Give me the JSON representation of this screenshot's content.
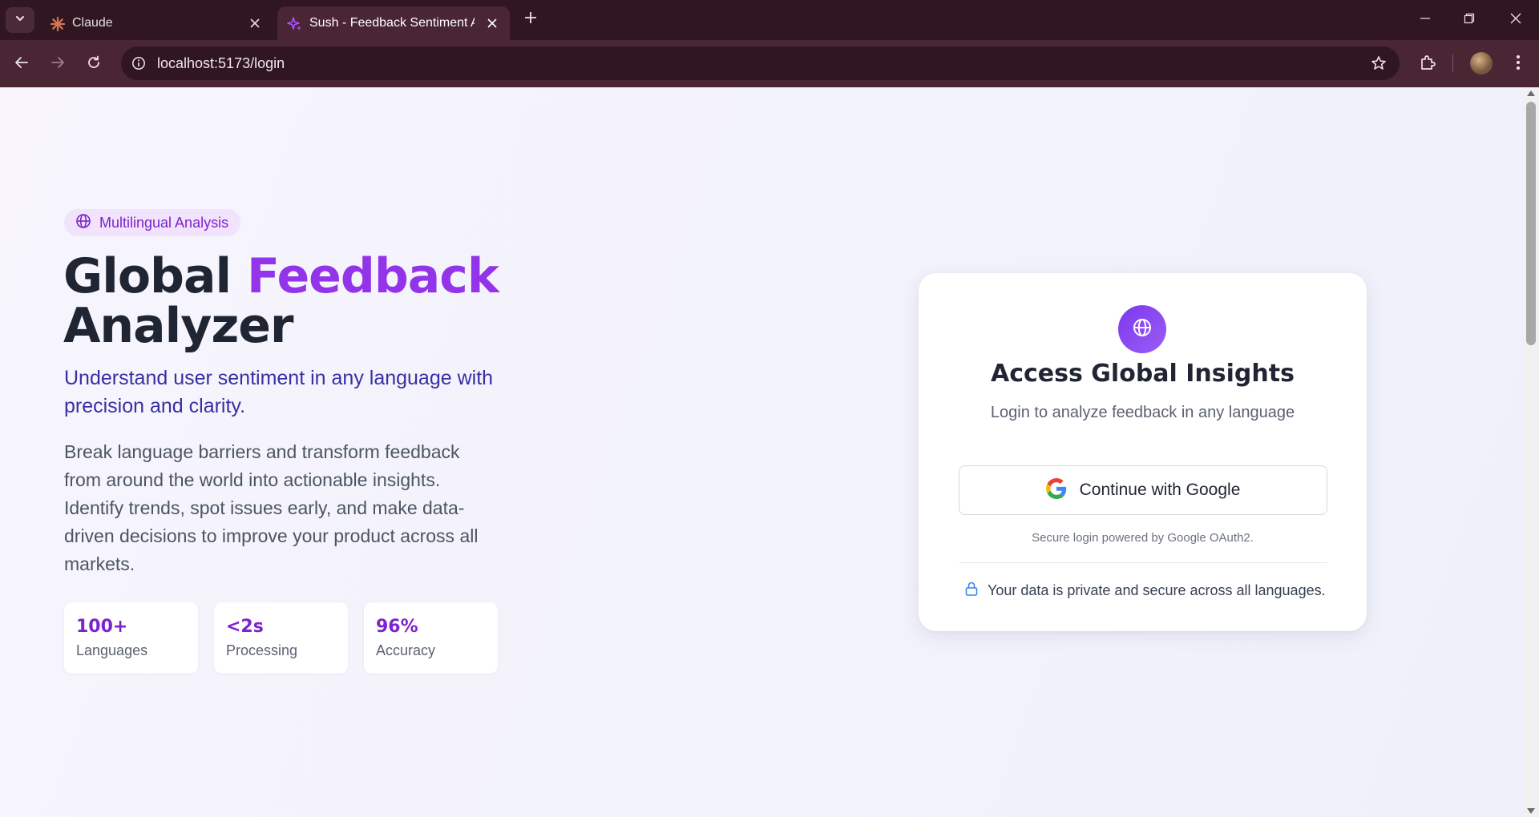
{
  "browser": {
    "tabs": [
      {
        "title": "Claude",
        "active": false
      },
      {
        "title": "Sush - Feedback Sentiment Ana",
        "active": true
      }
    ],
    "url": "localhost:5173/login"
  },
  "hero": {
    "badge": "Multilingual Analysis",
    "title_part1": "Global ",
    "title_accent": "Feedback",
    "title_part2": "Analyzer",
    "subtitle": "Understand user sentiment in any language with precision and clarity.",
    "description": "Break language barriers and transform feedback from around the world into actionable insights. Identify trends, spot issues early, and make data-driven decisions to improve your product across all markets.",
    "stats": [
      {
        "value": "100+",
        "label": "Languages"
      },
      {
        "value": "<2s",
        "label": "Processing"
      },
      {
        "value": "96%",
        "label": "Accuracy"
      }
    ]
  },
  "login": {
    "title": "Access Global Insights",
    "subtitle": "Login to analyze feedback in any language",
    "google_button": "Continue with Google",
    "secure_note": "Secure login powered by Google OAuth2.",
    "privacy_note": "Your data is private and secure across all languages."
  },
  "colors": {
    "accent_purple": "#9333ea",
    "subtitle_indigo": "#3730a3",
    "chrome_toolbar": "#4a2534"
  },
  "icons": [
    "tab-search-icon",
    "claude-favicon-icon",
    "sparkle-favicon-icon",
    "close-icon",
    "plus-icon",
    "minimize-icon",
    "restore-icon",
    "back-arrow-icon",
    "forward-arrow-icon",
    "reload-icon",
    "site-info-icon",
    "bookmark-star-icon",
    "extensions-icon",
    "more-menu-icon",
    "globe-icon",
    "google-logo-icon",
    "lock-icon"
  ]
}
